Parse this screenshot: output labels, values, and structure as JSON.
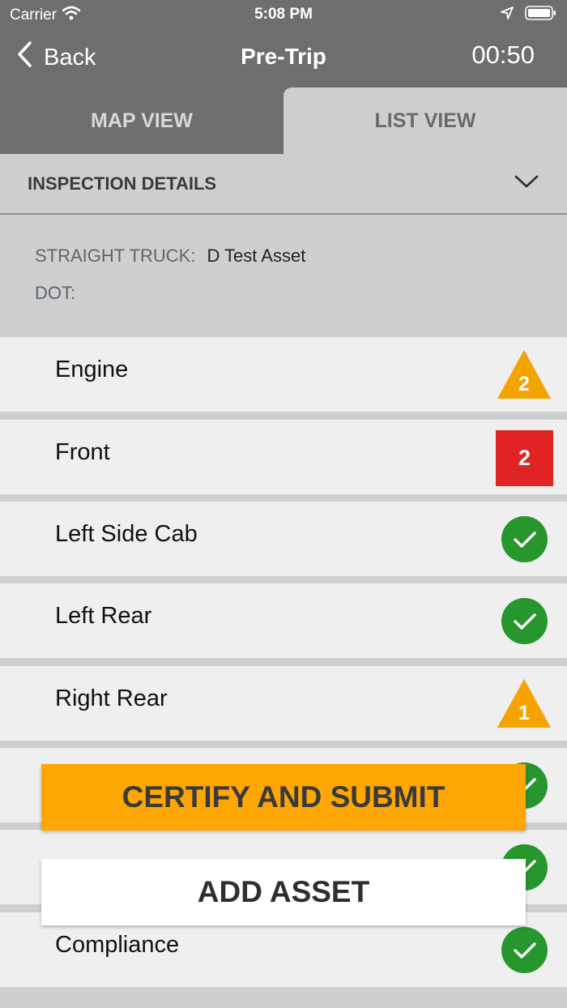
{
  "status_bar": {
    "carrier": "Carrier",
    "time": "5:08 PM"
  },
  "nav": {
    "back_label": "Back",
    "title": "Pre-Trip",
    "timer": "00:50"
  },
  "tabs": [
    {
      "label": "MAP VIEW",
      "selected": false
    },
    {
      "label": "LIST VIEW",
      "selected": true
    }
  ],
  "inspection_details": {
    "header": "INSPECTION DETAILS",
    "asset_type_label": "STRAIGHT TRUCK:",
    "asset_name": "D Test Asset",
    "dot_label": "DOT:",
    "dot_value": ""
  },
  "items": [
    {
      "name": "Engine",
      "status": "warning",
      "count": "2"
    },
    {
      "name": "Front",
      "status": "error",
      "count": "2"
    },
    {
      "name": "Left Side Cab",
      "status": "ok",
      "count": ""
    },
    {
      "name": "Left Rear",
      "status": "ok",
      "count": ""
    },
    {
      "name": "Right Rear",
      "status": "warning",
      "count": "1"
    },
    {
      "name": "",
      "status": "ok",
      "count": ""
    },
    {
      "name": "",
      "status": "ok",
      "count": ""
    },
    {
      "name": "Compliance",
      "status": "ok",
      "count": ""
    }
  ],
  "actions": {
    "certify_label": "CERTIFY AND SUBMIT",
    "add_asset_label": "ADD ASSET"
  },
  "colors": {
    "header_bg": "#6e6e6e",
    "warning": "#f5a300",
    "error": "#e02424",
    "ok": "#27962c",
    "certify": "#fea603"
  }
}
